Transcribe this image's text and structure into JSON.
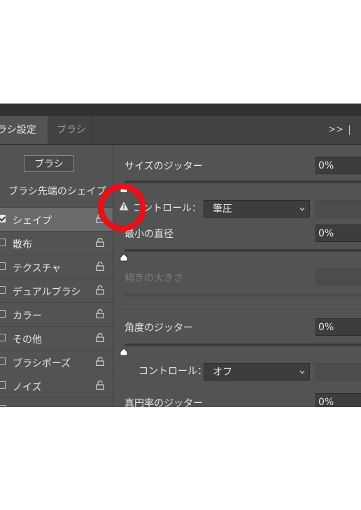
{
  "tabs": {
    "active": "ラシ設定",
    "inactive": "ブラシ",
    "expand": ">>"
  },
  "left": {
    "preset_button": "ブラシ",
    "tip_shape": "ブラシ先端のシェイプ",
    "options": [
      {
        "label": "シェイプ",
        "checked": true
      },
      {
        "label": "散布",
        "checked": false
      },
      {
        "label": "テクスチャ",
        "checked": false
      },
      {
        "label": "デュアルブラシ",
        "checked": false
      },
      {
        "label": "カラー",
        "checked": false
      },
      {
        "label": "その他",
        "checked": false
      },
      {
        "label": "ブラシポーズ",
        "checked": false
      },
      {
        "label": "ノイズ",
        "checked": false
      }
    ]
  },
  "right": {
    "size_jitter": {
      "label": "サイズのジッター",
      "value": "0%"
    },
    "control1": {
      "label": "コントロール：",
      "value": "筆圧"
    },
    "min_diameter": {
      "label": "最小の直径",
      "value": "0%"
    },
    "tilt_scale": {
      "label": "傾きの大きさ"
    },
    "angle_jitter": {
      "label": "角度のジッター",
      "value": "0%"
    },
    "control2": {
      "label": "コントロール：",
      "value": "オフ"
    },
    "roundness_jitter": {
      "label": "真円率のジッター",
      "value": "0%"
    }
  },
  "colors": {
    "panel": "#535353",
    "highlight_ring": "#e3121b"
  },
  "icons": [
    "lock-icon",
    "warning-icon",
    "chevron-down-icon",
    "slider-thumb-icon",
    "checkmark-icon"
  ]
}
